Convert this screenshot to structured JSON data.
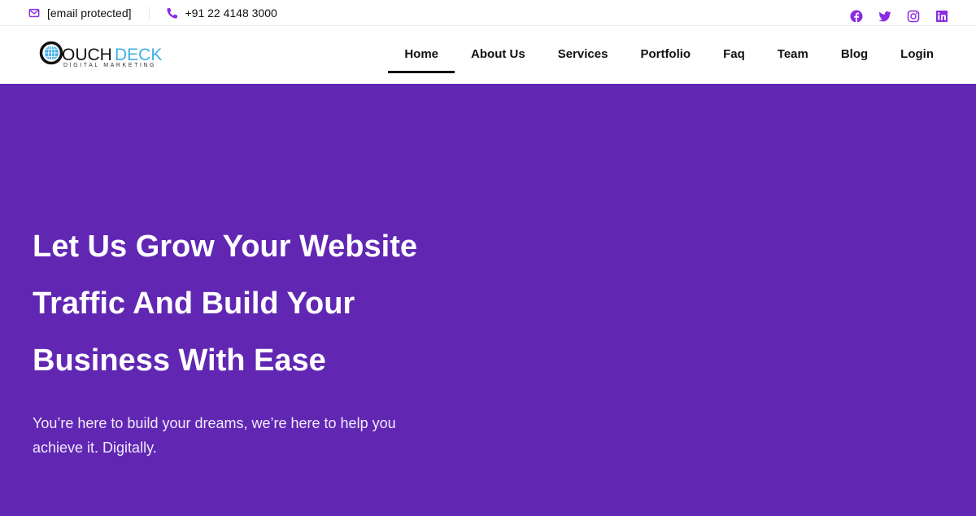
{
  "topbar": {
    "email": "[email protected]",
    "phone": "+91 22 4148 3000",
    "social": [
      {
        "name": "facebook",
        "icon": "facebook-icon"
      },
      {
        "name": "twitter",
        "icon": "twitter-icon"
      },
      {
        "name": "instagram",
        "icon": "instagram-icon"
      },
      {
        "name": "linkedin",
        "icon": "linkedin-icon"
      }
    ]
  },
  "brand": {
    "name_part1": "OUCH",
    "name_part2": "DECK",
    "tagline": "DIGITAL MARKETING",
    "accent_color": "#8a2be2",
    "hero_bg": "#6127b3"
  },
  "nav": {
    "items": [
      {
        "label": "Home",
        "active": true
      },
      {
        "label": "About Us"
      },
      {
        "label": "Services"
      },
      {
        "label": "Portfolio"
      },
      {
        "label": "Faq"
      },
      {
        "label": "Team"
      },
      {
        "label": "Blog"
      },
      {
        "label": "Login"
      }
    ]
  },
  "hero": {
    "headline_lines": [
      "Let Us Grow Your Website",
      "Traffic And Build Your",
      "Business With Ease"
    ],
    "subtext_line1": "You’re here to build your dreams, we’re here to help you",
    "subtext_line2": "achieve it. Digitally."
  }
}
